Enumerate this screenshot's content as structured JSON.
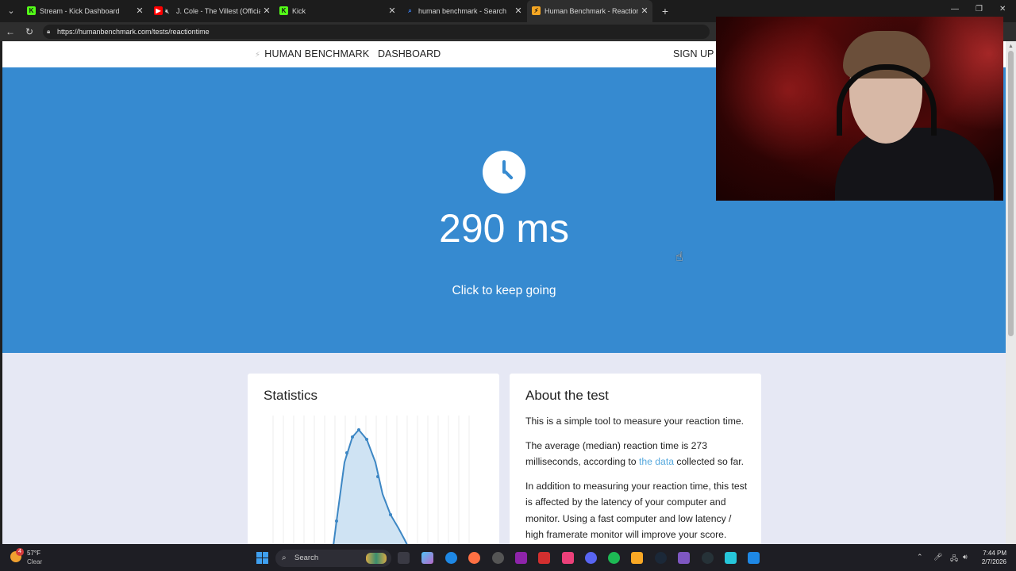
{
  "browser": {
    "tabs": [
      {
        "title": "Stream - Kick Dashboard",
        "favicon": "kick-icon",
        "color": "#53fc18"
      },
      {
        "title": "J. Cole - The Villest (Official Au",
        "favicon": "youtube-icon",
        "color": "#ff0000"
      },
      {
        "title": "Kick",
        "favicon": "kick-icon",
        "color": "#53fc18"
      },
      {
        "title": "human benchmark - Search",
        "favicon": "search-icon",
        "color": "#3b82f6"
      },
      {
        "title": "Human Benchmark - Reaction Tim",
        "favicon": "lightning-icon",
        "color": "#f5a623"
      }
    ],
    "url": "https://humanbenchmark.com/tests/reactiontime"
  },
  "site": {
    "logo": "HUMAN BENCHMARK",
    "nav_dashboard": "DASHBOARD",
    "nav_signup": "SIGN UP",
    "accent": "#368ad0"
  },
  "hero": {
    "result": "290 ms",
    "subtitle": "Click to keep going"
  },
  "statistics": {
    "title": "Statistics"
  },
  "about": {
    "title": "About the test",
    "p1": "This is a simple tool to measure your reaction time.",
    "p2_before": "The average (median) reaction time is 273 milliseconds, according to ",
    "p2_link": "the data",
    "p2_after": " collected so far.",
    "p3": "In addition to measuring your reaction time, this test is affected by the latency of your computer and monitor. Using a fast computer and low latency / high framerate monitor will improve your score."
  },
  "taskbar": {
    "weather_temp": "57°F",
    "weather_desc": "Clear",
    "weather_badge": "4",
    "search_label": "Search",
    "time": "7:44 PM",
    "date": "2/7/2026"
  }
}
